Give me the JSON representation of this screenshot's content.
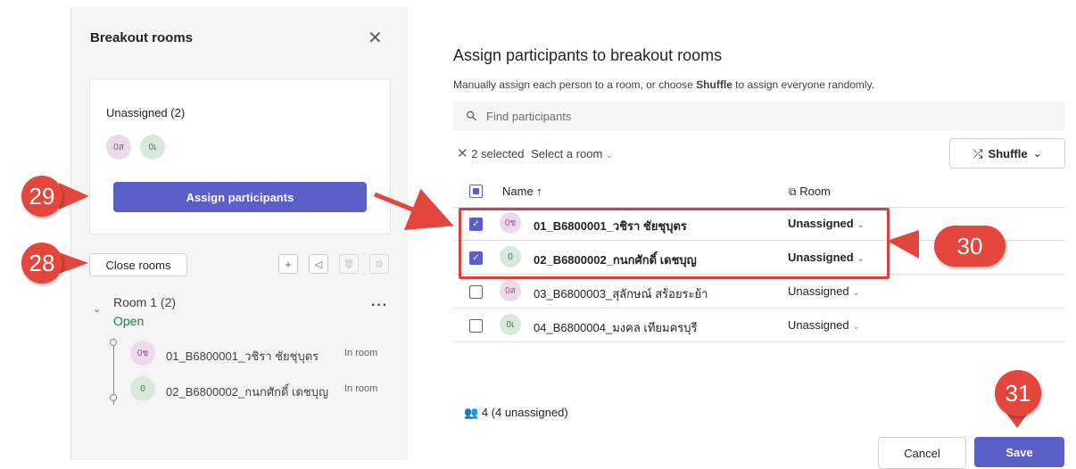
{
  "left_panel": {
    "title": "Breakout rooms",
    "close_glyph": "✕",
    "unassigned": {
      "label": "Unassigned (2)",
      "avatars": [
        "0ส",
        "0เ"
      ]
    },
    "assign_button": "Assign participants",
    "close_rooms_button": "Close rooms",
    "tools": [
      {
        "icon": "plus-icon",
        "glyph": "+",
        "disabled": false
      },
      {
        "icon": "announce-icon",
        "glyph": "◁",
        "disabled": false
      },
      {
        "icon": "delete-icon",
        "glyph": "🗑",
        "disabled": true
      },
      {
        "icon": "settings-icon",
        "glyph": "⚙",
        "disabled": true
      }
    ],
    "room": {
      "title": "Room 1 (2)",
      "status": "Open",
      "more": "···",
      "members": [
        {
          "avatar": "0ช",
          "name": "01_B6800001_วชิรา ชัยชุบุตร",
          "state": "In room"
        },
        {
          "avatar": "0",
          "name": "02_B6800002_กนกศักดิ์ เดชบุญ",
          "state": "In room"
        }
      ]
    }
  },
  "dialog": {
    "title": "Assign participants to breakout rooms",
    "subtitle_pre": "Manually assign each person to a room, or choose ",
    "subtitle_bold": "Shuffle",
    "subtitle_post": " to assign everyone randomly.",
    "search_placeholder": "Find participants",
    "selection": {
      "count": "2 selected",
      "select_room": "Select a room"
    },
    "shuffle_button": "Shuffle",
    "columns": {
      "name": "Name ↑",
      "room": "Room"
    },
    "rows": [
      {
        "avatar": "0ช",
        "avatar_color": "pink",
        "name": "01_B6800001_วชิรา ชัยชุบุตร",
        "room": "Unassigned",
        "checked": true,
        "bold": true
      },
      {
        "avatar": "0",
        "avatar_color": "green",
        "name": "02_B6800002_กนกศักดิ์ เดชบุญ",
        "room": "Unassigned",
        "checked": true,
        "bold": true
      },
      {
        "avatar": "0ส",
        "avatar_color": "pink",
        "name": "03_B6800003_สุลักษณ์ สร้อยระย้า",
        "room": "Unassigned",
        "checked": false,
        "bold": false
      },
      {
        "avatar": "0เ",
        "avatar_color": "green",
        "name": "04_B6800004_มงคล เทียมครบุรี",
        "room": "Unassigned",
        "checked": false,
        "bold": false
      }
    ],
    "participant_count": "4 (4 unassigned)",
    "cancel_button": "Cancel",
    "save_button": "Save"
  },
  "callouts": [
    "28",
    "29",
    "30",
    "31"
  ],
  "colors": {
    "accent": "#5b5fc7",
    "callout": "#e2463c",
    "open": "#237b4b"
  }
}
